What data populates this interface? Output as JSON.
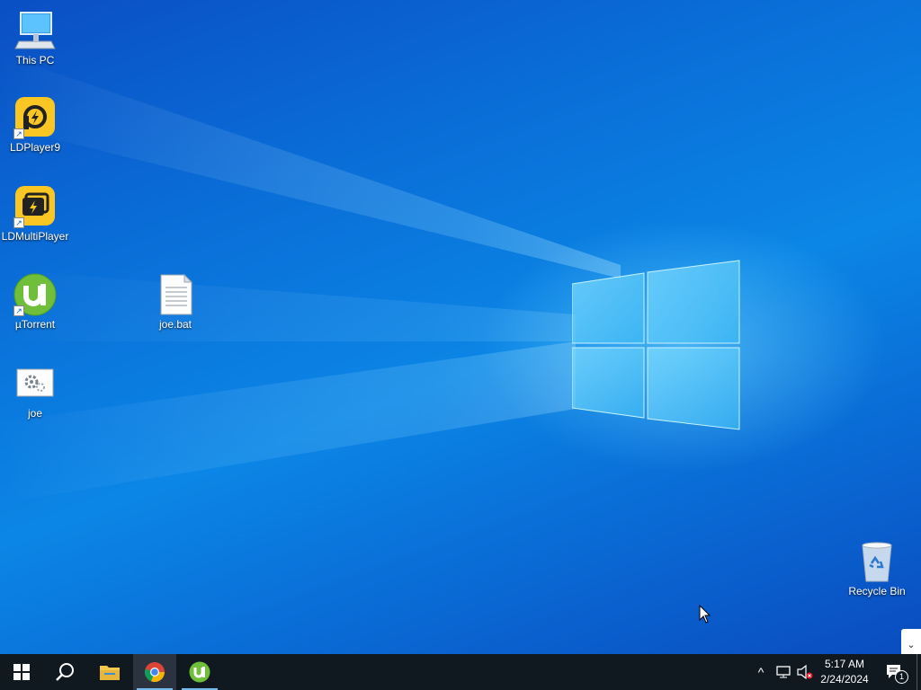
{
  "desktop": {
    "icons": [
      {
        "label": "This PC",
        "icon": "computer-icon"
      },
      {
        "label": "LDPlayer9",
        "icon": "ldplayer-icon"
      },
      {
        "label": "LDMultiPlayer",
        "icon": "ldmultiplayer-icon"
      },
      {
        "label": "µTorrent",
        "icon": "utorrent-icon"
      },
      {
        "label": "joe.bat",
        "icon": "batch-file-icon"
      },
      {
        "label": "joe",
        "icon": "settings-file-icon"
      },
      {
        "label": "Recycle Bin",
        "icon": "recycle-bin-icon"
      }
    ]
  },
  "taskbar": {
    "pinned": [
      {
        "name": "Start",
        "icon": "windows-start-icon"
      },
      {
        "name": "Search",
        "icon": "search-icon"
      },
      {
        "name": "File Explorer",
        "icon": "folder-icon"
      },
      {
        "name": "Google Chrome",
        "icon": "chrome-icon"
      },
      {
        "name": "µTorrent",
        "icon": "utorrent-icon"
      }
    ],
    "tray": {
      "show_hidden": "^",
      "notification_count": "1"
    },
    "clock": {
      "time": "5:17 AM",
      "date": "2/24/2024"
    }
  },
  "colors": {
    "taskbar": "#101820",
    "utorrent_green": "#6fbf3a",
    "ldplayer_yellow": "#f9c623"
  }
}
